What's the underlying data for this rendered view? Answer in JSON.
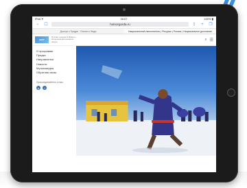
{
  "status_bar": {
    "left": "iPad ✦",
    "time": "16:07",
    "right": "100% ▮"
  },
  "browser": {
    "url": "hotnorgorda.ru",
    "tabs": [
      "Доступ к Тундре · Олени и Люди",
      "Национальный наполнитель | Ресурсы | Россия | Национальное достояние"
    ]
  },
  "site": {
    "logo_text": "НОРГ",
    "tagline": "Портал о жизни в Ямало-Ненецком автономном округе",
    "menu": [
      "О программе",
      "Предки",
      "Направления",
      "Новости",
      "Мультимедиа",
      "Обратная связь"
    ],
    "social_caption": "Присоединяйтесь к нам"
  },
  "colors": {
    "accent": "#3b6fb0",
    "bezel": "#1b1b1b",
    "sky": "#2f6ec4",
    "snow": "#f2f4f8"
  }
}
